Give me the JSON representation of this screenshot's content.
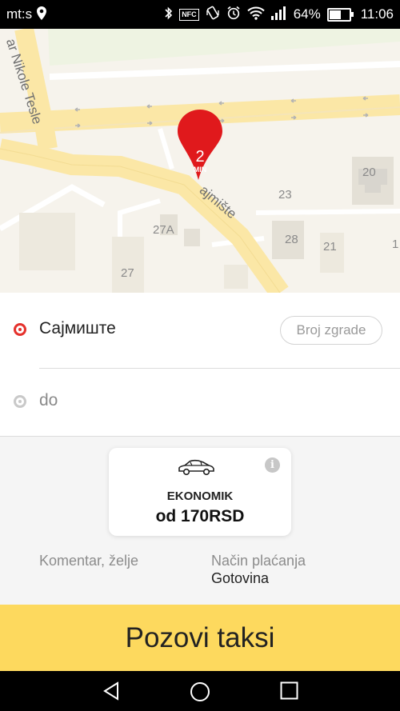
{
  "status_bar": {
    "carrier": "mt:s",
    "nfc": "NFC",
    "battery_percent": "64%",
    "battery_level": 0.64,
    "time": "11:06",
    "icons": [
      "location-icon",
      "bluetooth-icon",
      "nfc-icon",
      "vibrate-icon",
      "alarm-icon",
      "wifi-icon",
      "signal-icon",
      "battery-icon"
    ]
  },
  "map": {
    "street_nikole_tesle": "ar Nikole Tesle",
    "street_sajmiste": "ajmište",
    "house_numbers": [
      "20",
      "23",
      "27A",
      "28",
      "21",
      "1",
      "27"
    ],
    "pin": {
      "number": "2",
      "unit": "MIN",
      "color": "#e0191c"
    }
  },
  "route": {
    "from": "Сајмиште",
    "building_button": "Broj zgrade",
    "to_placeholder": "do"
  },
  "vehicle": {
    "type": "EKONOMIK",
    "price": "od 170RSD"
  },
  "options": {
    "comment": "Komentar, želje",
    "payment_label": "Način plaćanja",
    "payment_value": "Gotovina"
  },
  "call_button": "Pozovi taksi",
  "colors": {
    "accent_yellow": "#fdd95e",
    "pin_red": "#e0191c",
    "road_yellow": "#fbe7a6"
  }
}
